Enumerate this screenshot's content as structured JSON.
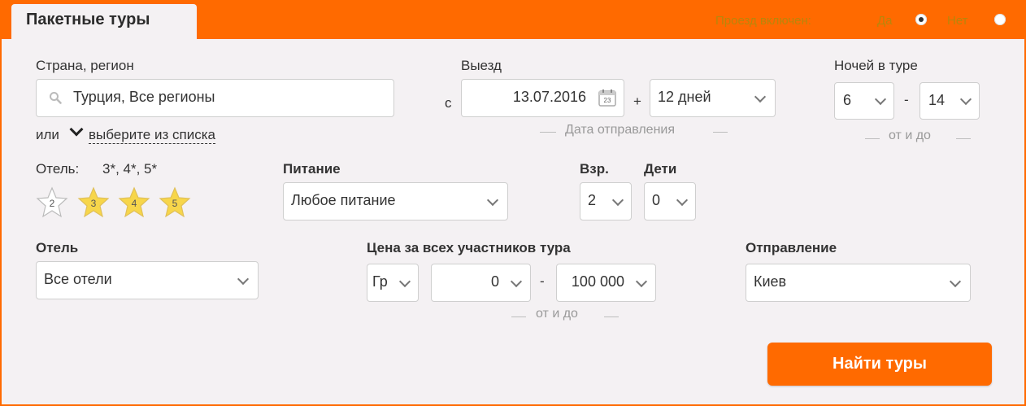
{
  "tab": {
    "label": "Пакетные туры"
  },
  "transfer": {
    "label": "Проезд включен:",
    "yes": "Да",
    "no": "Нет",
    "selected": "yes"
  },
  "destination": {
    "label": "Страна, регион",
    "value": "Турция, Все регионы",
    "or_text": "или",
    "choose_link": "выберите из списка"
  },
  "departure": {
    "label": "Выезд",
    "from_prefix": "с",
    "date": "13.07.2016",
    "calendar_day": "23",
    "plus": "+",
    "days": "12 дней",
    "hint": "Дата отправления"
  },
  "nights": {
    "label": "Ночей в туре",
    "from": "6",
    "separator": "-",
    "to": "14",
    "hint": "от и до"
  },
  "hotel_category": {
    "label": "Отель:",
    "value": "3*, 4*, 5*",
    "stars": [
      "2",
      "3",
      "4",
      "5"
    ]
  },
  "meal": {
    "label": "Питание",
    "value": "Любое питание"
  },
  "adults": {
    "label": "Взр.",
    "value": "2"
  },
  "children": {
    "label": "Дети",
    "value": "0"
  },
  "hotel": {
    "label": "Отель",
    "value": "Все отели"
  },
  "price": {
    "label": "Цена за всех участников тура",
    "currency": "Гр",
    "from": "0",
    "separator": "-",
    "to": "100 000",
    "hint": "от и до"
  },
  "departure_city": {
    "label": "Отправление",
    "value": "Киев"
  },
  "search": {
    "label": "Найти туры"
  },
  "colors": {
    "accent": "#ff6a00",
    "panel": "#f4f1f3",
    "star_active": "#f7d64a",
    "transfer_text": "#b8860b"
  }
}
